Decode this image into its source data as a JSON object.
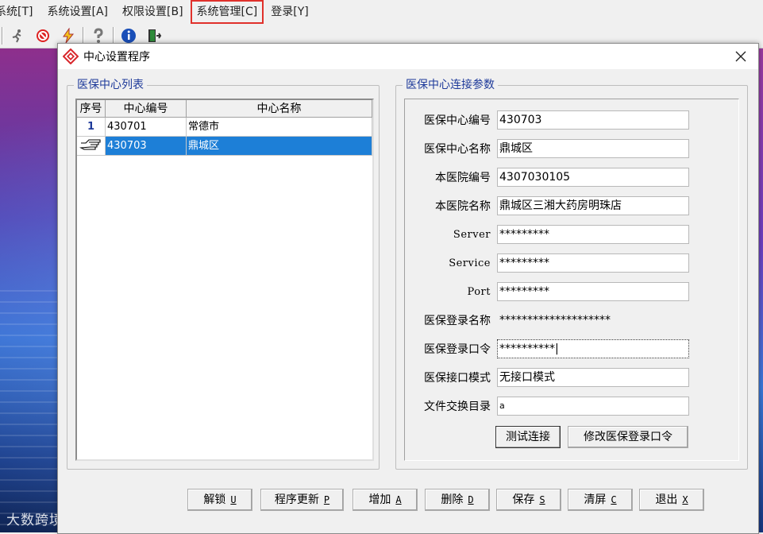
{
  "menubar": {
    "items": [
      "系统[T]",
      "系统设置[A]",
      "权限设置[B]",
      "系统管理[C]",
      "登录[Y]"
    ]
  },
  "toolbar": {
    "icons": [
      "runner-icon",
      "stop-icon",
      "lightning-icon",
      "help-icon",
      "info-icon",
      "exit-door-icon"
    ]
  },
  "dialog": {
    "title": "中心设置程序",
    "left_group": {
      "title": "医保中心列表",
      "columns": [
        "序号",
        "中心编号",
        "中心名称"
      ],
      "rows": [
        {
          "no": "1",
          "code": "430701",
          "name": "常德市"
        },
        {
          "no": "",
          "code": "430703",
          "name": "鼎城区"
        }
      ]
    },
    "right_group": {
      "title": "医保中心连接参数",
      "fields": [
        {
          "label": "医保中心编号",
          "value": "430703"
        },
        {
          "label": "医保中心名称",
          "value": "鼎城区"
        },
        {
          "label": "本医院编号",
          "value": "4307030105"
        },
        {
          "label": "本医院名称",
          "value": "鼎城区三湘大药房明珠店"
        },
        {
          "label": "Server",
          "value": "*********"
        },
        {
          "label": "Service",
          "value": "*********"
        },
        {
          "label": "Port",
          "value": "*********"
        },
        {
          "label": "医保登录名称",
          "value": "********************"
        },
        {
          "label": "医保登录口令",
          "value": "**********|"
        },
        {
          "label": "医保接口模式",
          "value": "无接口模式"
        },
        {
          "label": "文件交换目录",
          "value": "a"
        }
      ],
      "test_button": "测试连接",
      "change_password_button": "修改医保登录口令"
    },
    "buttons": [
      {
        "label": "解锁",
        "hotkey": "U"
      },
      {
        "label": "程序更新",
        "hotkey": "P"
      },
      {
        "label": "增加",
        "hotkey": "A"
      },
      {
        "label": "删除",
        "hotkey": "D"
      },
      {
        "label": "保存",
        "hotkey": "S"
      },
      {
        "label": "清屏",
        "hotkey": "C"
      },
      {
        "label": "退出",
        "hotkey": "X"
      }
    ]
  },
  "watermark": "大数跨境",
  "colors": {
    "selection": "#1d7fd7",
    "group_title": "#1e3a9a",
    "highlight_outline": "#e0312b"
  }
}
